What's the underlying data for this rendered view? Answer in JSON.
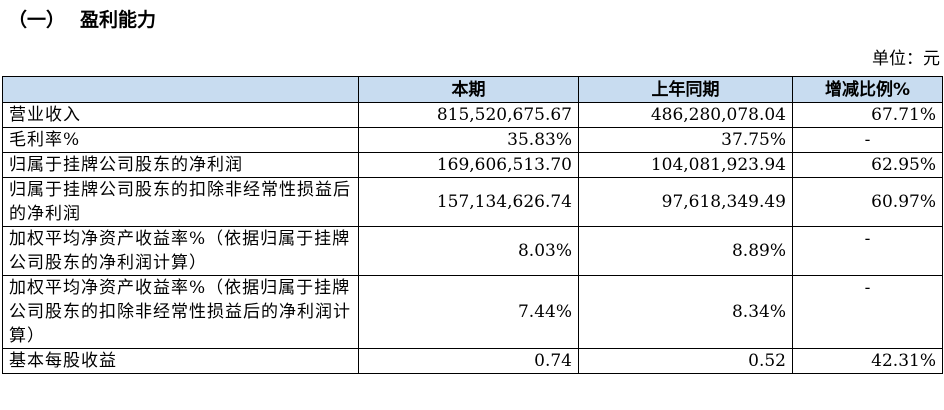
{
  "section": {
    "number": "（一）",
    "title": "盈利能力"
  },
  "unit_label": "单位：元",
  "table": {
    "headers": [
      "",
      "本期",
      "上年同期",
      "增减比例%"
    ],
    "rows": [
      {
        "label": "营业收入",
        "current": "815,520,675.67",
        "previous": "486,280,078.04",
        "change": "67.71%"
      },
      {
        "label": "毛利率%",
        "current": "35.83%",
        "previous": "37.75%",
        "change": "-"
      },
      {
        "label": "归属于挂牌公司股东的净利润",
        "current": "169,606,513.70",
        "previous": "104,081,923.94",
        "change": "62.95%"
      },
      {
        "label": "归属于挂牌公司股东的扣除非经常性损益后的净利润",
        "current": "157,134,626.74",
        "previous": "97,618,349.49",
        "change": "60.97%"
      },
      {
        "label": "加权平均净资产收益率%（依据归属于挂牌公司股东的净利润计算）",
        "current": "8.03%",
        "previous": "8.89%",
        "change": "-"
      },
      {
        "label": "加权平均净资产收益率%（依据归属于挂牌公司股东的扣除非经常性损益后的净利润计算）",
        "current": "7.44%",
        "previous": "8.34%",
        "change": "-"
      },
      {
        "label": "基本每股收益",
        "current": "0.74",
        "previous": "0.52",
        "change": "42.31%"
      }
    ]
  }
}
